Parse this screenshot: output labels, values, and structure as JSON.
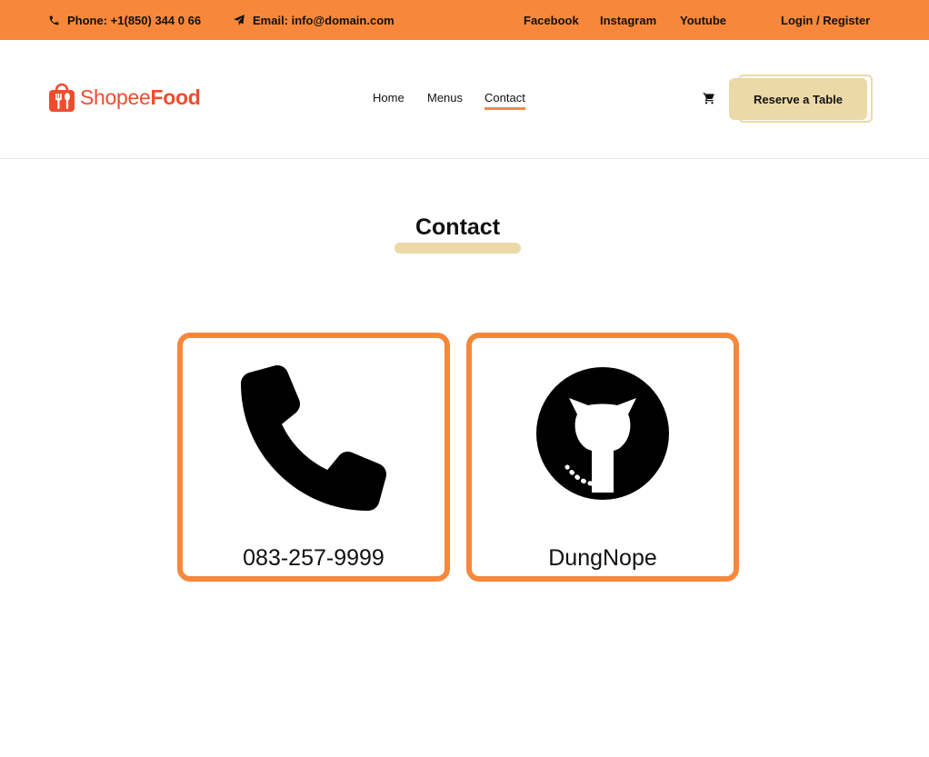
{
  "topbar": {
    "phone": "Phone: +1(850) 344 0 66",
    "email": "Email: info@domain.com",
    "social": [
      "Facebook",
      "Instagram",
      "Youtube"
    ],
    "auth": "Login / Register"
  },
  "header": {
    "logo": {
      "part1": "Shopee",
      "part2": "Food"
    },
    "nav": [
      "Home",
      "Menus",
      "Contact"
    ],
    "active_nav": "Contact",
    "cart_icon": "cart-icon",
    "reserve_label": "Reserve a Table"
  },
  "main": {
    "title": "Contact",
    "cards": [
      {
        "icon": "phone-icon",
        "label": "083-257-9999"
      },
      {
        "icon": "github-icon",
        "label": "DungNope"
      }
    ]
  },
  "colors": {
    "accent": "#f7883b",
    "brand": "#ee4d2d",
    "button": "#ecd9a8"
  }
}
